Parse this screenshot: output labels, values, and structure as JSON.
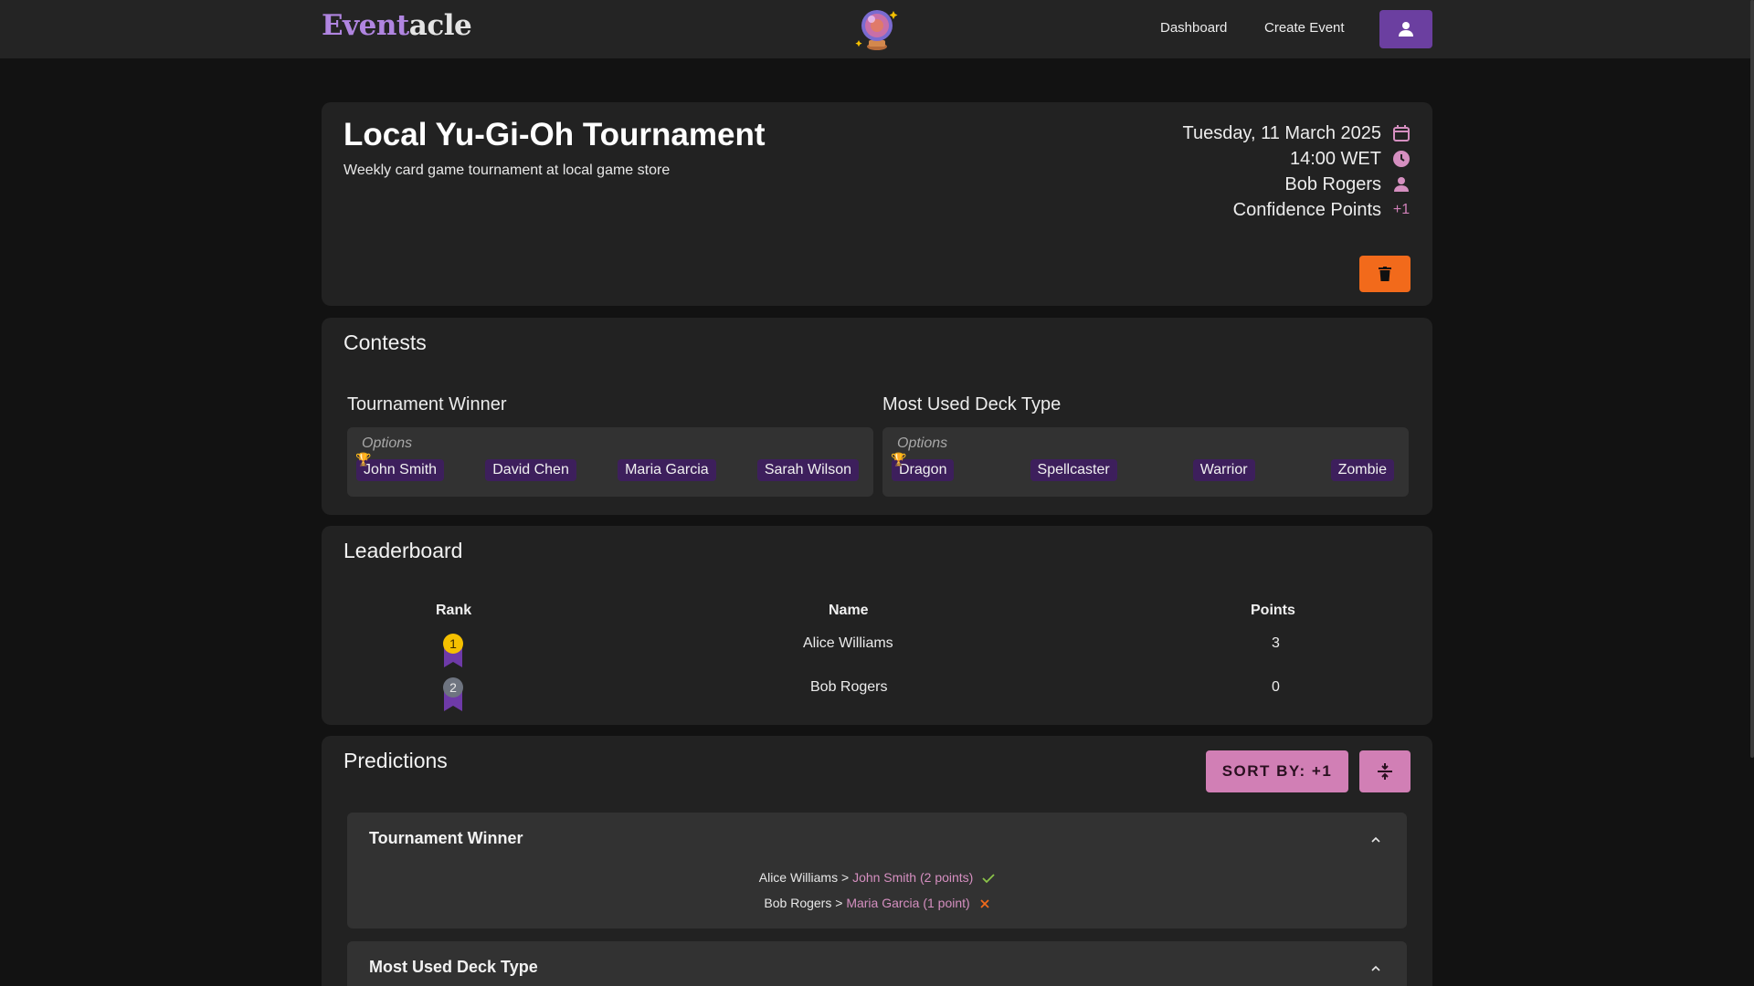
{
  "nav": {
    "brand_part1": "Event",
    "brand_part2": "acle",
    "dashboard_label": "Dashboard",
    "create_label": "Create Event",
    "icons": {
      "logo": "crystal-ball-icon",
      "user": "user-icon"
    }
  },
  "event": {
    "title": "Local Yu-Gi-Oh Tournament",
    "description": "Weekly card game tournament at local game store",
    "date": "Tuesday, 11 March 2025",
    "time": "14:00 WET",
    "organizer": "Bob Rogers",
    "scoring_label": "Confidence Points",
    "scoring_value": "+1",
    "icons": [
      "calendar-icon",
      "clock-icon",
      "person-icon",
      "trash-icon"
    ]
  },
  "contests": {
    "title": "Contests",
    "options_label": "Options",
    "items": [
      {
        "name": "Tournament Winner",
        "options": [
          "John Smith",
          "David Chen",
          "Maria Garcia",
          "Sarah Wilson"
        ],
        "winner_index": 0
      },
      {
        "name": "Most Used Deck Type",
        "options": [
          "Dragon",
          "Spellcaster",
          "Warrior",
          "Zombie"
        ],
        "winner_index": 0
      }
    ]
  },
  "leaderboard": {
    "title": "Leaderboard",
    "columns": [
      "Rank",
      "Name",
      "Points"
    ],
    "rows": [
      {
        "rank": "1",
        "name": "Alice Williams",
        "points": "3"
      },
      {
        "rank": "2",
        "name": "Bob Rogers",
        "points": "0"
      }
    ]
  },
  "predictions": {
    "title": "Predictions",
    "sort_label": "SORT BY: +1",
    "sections": [
      {
        "title": "Tournament Winner",
        "lines": [
          {
            "user": "Alice Williams",
            "sep": ">",
            "pick": "John Smith (2 points)",
            "correct": true
          },
          {
            "user": "Bob Rogers",
            "sep": ">",
            "pick": "Maria Garcia (1 point)",
            "correct": false
          }
        ]
      },
      {
        "title": "Most Used Deck Type",
        "lines": []
      }
    ]
  },
  "colors": {
    "accent_purple": "#6b3fa0",
    "chip_purple": "#3d1f5c",
    "pink": "#d17fb5",
    "delete_orange": "#f26a1b",
    "gold": "#f5c000",
    "silver": "#6e7480",
    "correct_green": "#8bc34a",
    "wrong_orange": "#f26a1b"
  }
}
